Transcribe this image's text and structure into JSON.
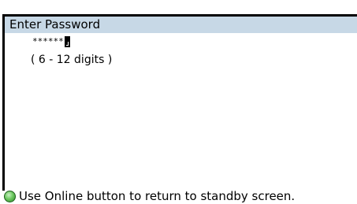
{
  "title": "Enter Password",
  "password": {
    "masked_value": "******"
  },
  "hint": "( 6 - 12 digits )",
  "footer": {
    "icon": "green-circle-icon",
    "text": "Use Online button to return to standby screen."
  },
  "colors": {
    "titlebar_bg": "#c7d8e6",
    "text": "#000000",
    "online_icon": "#6ec962"
  }
}
